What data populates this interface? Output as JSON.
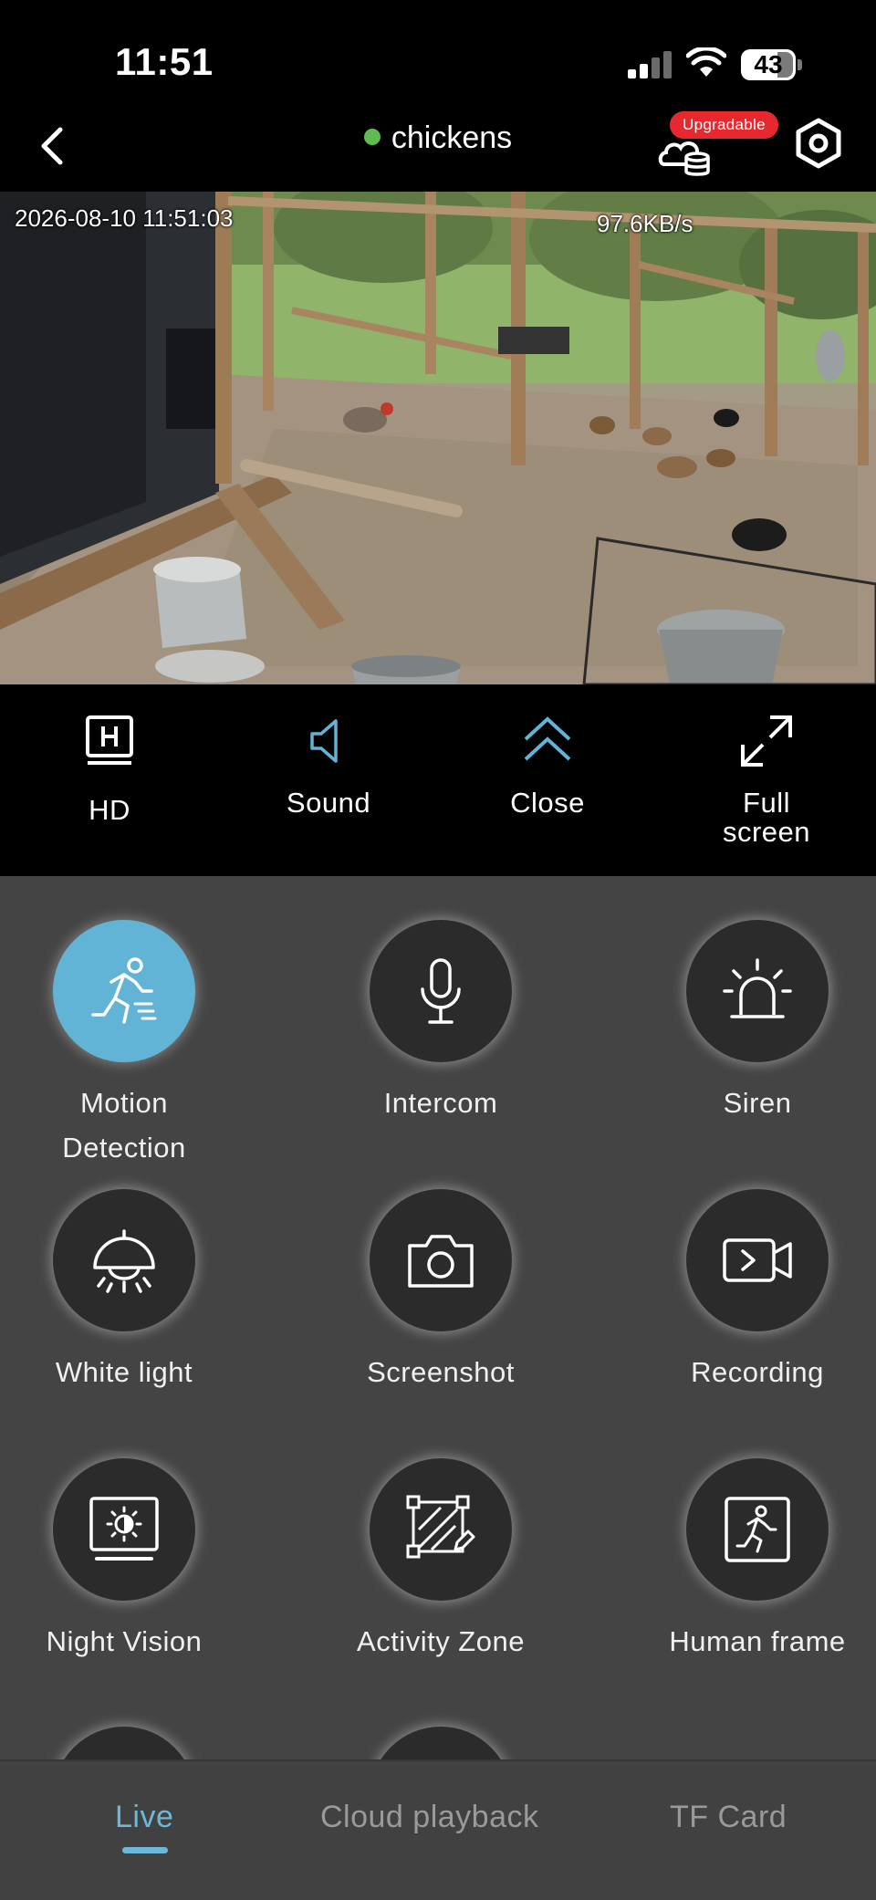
{
  "status_bar": {
    "time": "11:51",
    "battery": "43",
    "battery_level": 0.43
  },
  "header": {
    "title": "chickens",
    "online_color": "#5dbb4f",
    "upgrade_badge": "Upgradable",
    "icons": {
      "back": "chevron-left-icon",
      "storage": "cloud-storage-icon",
      "settings": "hexagon-settings-icon"
    }
  },
  "video": {
    "timestamp": "2026-08-10 11:51:03",
    "bitrate": "97.6KB/s"
  },
  "controls": [
    {
      "label": "HD",
      "icon": "hd-icon"
    },
    {
      "label": "Sound",
      "icon": "speaker-icon"
    },
    {
      "label": "Close",
      "icon": "double-chevron-up-icon"
    },
    {
      "label": "Full\nscreen",
      "icon": "fullscreen-icon"
    }
  ],
  "features": [
    {
      "label": "Motion\nDetection",
      "icon": "running-person-icon",
      "active": true
    },
    {
      "label": "Intercom",
      "icon": "microphone-icon",
      "active": false
    },
    {
      "label": "Siren",
      "icon": "siren-icon",
      "active": false
    },
    {
      "label": "White light",
      "icon": "ceiling-light-icon",
      "active": false
    },
    {
      "label": "Screenshot",
      "icon": "camera-icon",
      "active": false
    },
    {
      "label": "Recording",
      "icon": "video-record-icon",
      "active": false
    },
    {
      "label": "Night Vision",
      "icon": "night-vision-icon",
      "active": false
    },
    {
      "label": "Activity Zone",
      "icon": "activity-zone-icon",
      "active": false
    },
    {
      "label": "Human frame",
      "icon": "human-frame-icon",
      "active": false
    }
  ],
  "tabs": [
    {
      "label": "Live",
      "active": true
    },
    {
      "label": "Cloud playback",
      "active": false
    },
    {
      "label": "TF Card",
      "active": false
    }
  ],
  "colors": {
    "accent": "#61b4d6",
    "panel_bg": "#444444",
    "badge_red": "#e7282e"
  }
}
